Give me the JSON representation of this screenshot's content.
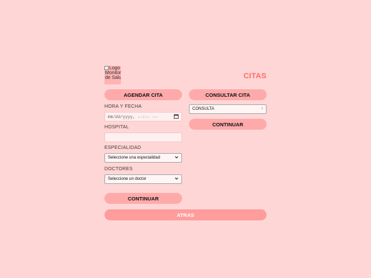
{
  "logo": {
    "alt": "Logo Monitor de Salud"
  },
  "page": {
    "title": "CITAS"
  },
  "left": {
    "tab_label": "AGENDAR CITA",
    "fecha_label": "HORA Y FECHA",
    "fecha_value": "mm/dd/yyyy, --:-- --",
    "hospital_label": "HOSPITAL",
    "hospital_value": "",
    "especialidad_label": "ESPECIALIDAD",
    "especialidad_value": "Seleccione una especialidad",
    "doctores_label": "DOCTORES",
    "doctores_value": "Seleccione un doctor",
    "continuar_label": "CONTINUAR"
  },
  "right": {
    "tab_label": "CONSULTAR CITA",
    "consulta_value": "CONSULTA",
    "continuar_label": "CONTINUAR"
  },
  "footer": {
    "atras_label": "ATRAS"
  },
  "colors": {
    "background": "#ffd6d6",
    "button": "#ffaaaa",
    "accent": "#ff6b6b",
    "atras": "#ff9c9c"
  }
}
